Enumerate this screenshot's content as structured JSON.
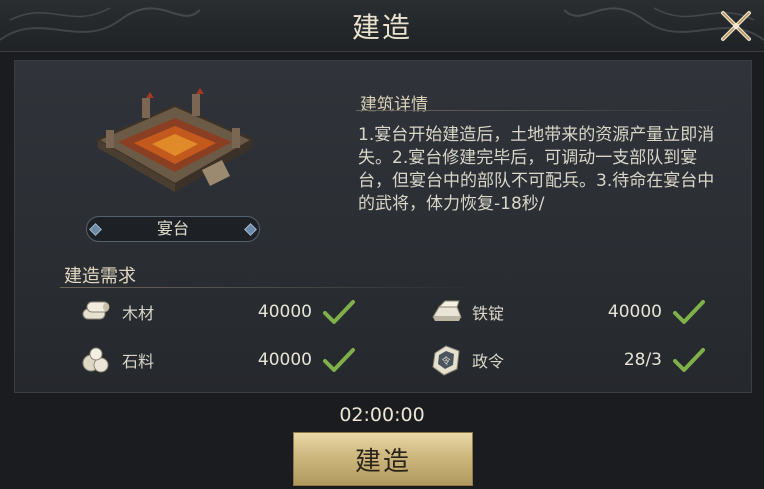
{
  "header": {
    "title": "建造"
  },
  "building": {
    "name": "宴台"
  },
  "details": {
    "title": "建筑详情",
    "text": "1.宴台开始建造后，土地带来的资源产量立即消失。2.宴台修建完毕后，可调动一支部队到宴台，但宴台中的部队不可配兵。3.待命在宴台中的武将，体力恢复-18秒/"
  },
  "requirements": {
    "title": "建造需求",
    "items": [
      {
        "name": "木材",
        "amount": "40000",
        "icon": "wood-icon"
      },
      {
        "name": "铁锭",
        "amount": "40000",
        "icon": "iron-ingot-icon"
      },
      {
        "name": "石料",
        "amount": "40000",
        "icon": "stone-icon"
      },
      {
        "name": "政令",
        "amount": "28/3",
        "icon": "decree-icon"
      }
    ]
  },
  "timer": "02:00:00",
  "actions": {
    "build_label": "建造"
  },
  "colors": {
    "check": "#7fb04a",
    "button_gold": "#cdb77e",
    "background": "#1a1c1f"
  }
}
